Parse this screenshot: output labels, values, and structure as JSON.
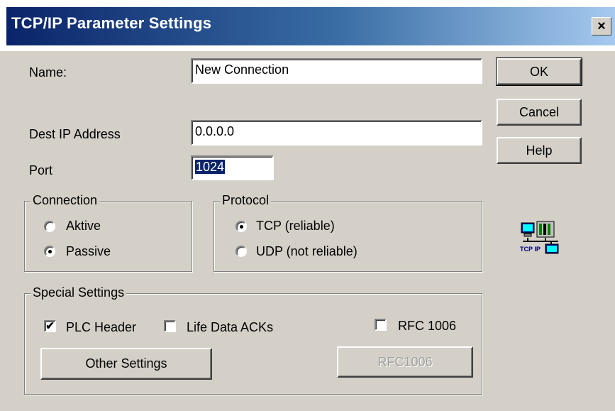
{
  "window": {
    "title": "TCP/IP Parameter Settings",
    "close_glyph": "×"
  },
  "fields": {
    "name_label": "Name:",
    "name_value": "New Connection",
    "dest_ip_label": "Dest IP Address",
    "dest_ip_value": "0.0.0.0",
    "port_label": "Port",
    "port_value": "1024"
  },
  "buttons": {
    "ok": "OK",
    "cancel": "Cancel",
    "help": "Help",
    "other_settings": "Other Settings",
    "rfc1006": "RFC1006"
  },
  "connection": {
    "legend": "Connection",
    "aktive": "Aktive",
    "passive": "Passive",
    "selected": "Passive"
  },
  "protocol": {
    "legend": "Protocol",
    "tcp": "TCP (reliable)",
    "udp": "UDP (not reliable)",
    "selected": "TCP (reliable)"
  },
  "special": {
    "legend": "Special Settings",
    "plc_header": "PLC Header",
    "plc_header_checked": true,
    "life_data_acks": "Life Data ACKs",
    "life_data_acks_checked": false,
    "rfc_1006": "RFC 1006",
    "rfc_1006_checked": false
  },
  "icons": {
    "tcpip": "tcpip-network-icon",
    "tcpip_caption": "TCP IP"
  },
  "colors": {
    "title_start": "#0a246a",
    "title_end": "#a6caf0",
    "face": "#d4d0c8",
    "selection": "#0a246a"
  }
}
